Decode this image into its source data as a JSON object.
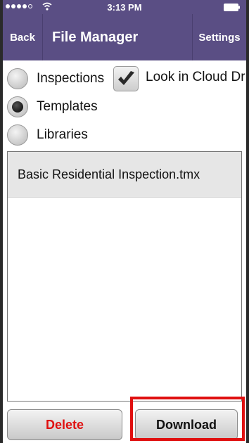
{
  "status_bar": {
    "time": "3:13 PM"
  },
  "nav": {
    "back_label": "Back",
    "title": "File Manager",
    "settings_label": "Settings"
  },
  "options": {
    "inspections": "Inspections",
    "templates": "Templates",
    "libraries": "Libraries",
    "selected": "Templates"
  },
  "cloud": {
    "label": "Look in Cloud Dr",
    "checked": true
  },
  "files": {
    "items": [
      "Basic Residential Inspection.tmx"
    ]
  },
  "actions": {
    "delete_label": "Delete",
    "download_label": "Download"
  },
  "colors": {
    "nav_background": "#5a4e84",
    "delete_text": "#e01010",
    "highlight": "#e01010"
  },
  "icons": {
    "signal": "signal-dots-icon",
    "wifi": "wifi-icon",
    "battery": "battery-icon",
    "checkmark": "checkmark-icon"
  }
}
